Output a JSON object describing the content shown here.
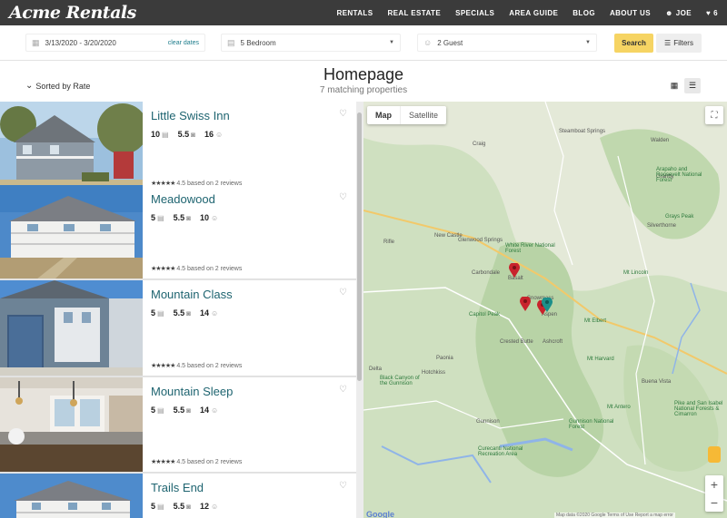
{
  "nav": {
    "logo": "Acme Rentals",
    "links": [
      "RENTALS",
      "REAL ESTATE",
      "SPECIALS",
      "AREA GUIDE",
      "BLOG",
      "ABOUT US"
    ],
    "user": "JOE",
    "favorites_count": "6"
  },
  "search": {
    "dates": "3/13/2020 - 3/20/2020",
    "clear_dates": "clear dates",
    "bedrooms": "5 Bedroom",
    "guests": "2 Guest",
    "search_label": "Search",
    "filters_label": "Filters"
  },
  "page": {
    "title": "Homepage",
    "subtitle": "7 matching properties",
    "sort_label": "Sorted by Rate"
  },
  "properties": [
    {
      "name": "Little Swiss Inn",
      "beds": "10",
      "baths": "5.5",
      "guests": "16",
      "rating": "4.5",
      "reviews": "based on 2 reviews"
    },
    {
      "name": "Meadowood",
      "beds": "5",
      "baths": "5.5",
      "guests": "10",
      "rating": "4.5",
      "reviews": "based on 2 reviews"
    },
    {
      "name": "Mountain Class",
      "beds": "5",
      "baths": "5.5",
      "guests": "14",
      "rating": "4.5",
      "reviews": "based on 2 reviews"
    },
    {
      "name": "Mountain Sleep",
      "beds": "5",
      "baths": "5.5",
      "guests": "14",
      "rating": "4.5",
      "reviews": "based on 2 reviews"
    },
    {
      "name": "Trails End",
      "beds": "5",
      "baths": "5.5",
      "guests": "12",
      "rating": "",
      "reviews": ""
    }
  ],
  "map": {
    "map_tab": "Map",
    "satellite_tab": "Satellite",
    "logo_text": "Google",
    "copyright": "Map data ©2020 Google   Terms of Use   Report a map error",
    "places": [
      {
        "name": "Craig"
      },
      {
        "name": "Steamboat Springs"
      },
      {
        "name": "Walden"
      },
      {
        "name": "Rifle"
      },
      {
        "name": "New Castle"
      },
      {
        "name": "Glenwood Springs"
      },
      {
        "name": "Carbondale"
      },
      {
        "name": "Basalt"
      },
      {
        "name": "Aspen"
      },
      {
        "name": "Snowmass"
      },
      {
        "name": "Capitol Peak"
      },
      {
        "name": "Mt Elbert"
      },
      {
        "name": "Ashcroft"
      },
      {
        "name": "Mt Harvard"
      },
      {
        "name": "Mt Lincoln"
      },
      {
        "name": "Silverthorne"
      },
      {
        "name": "Grays Peak"
      },
      {
        "name": "Granby"
      },
      {
        "name": "Buena Vista"
      },
      {
        "name": "Gunnison"
      },
      {
        "name": "Crested Butte"
      },
      {
        "name": "Paonia"
      },
      {
        "name": "Hotchkiss"
      },
      {
        "name": "Delta"
      },
      {
        "name": "Mt Antero"
      },
      {
        "name": "White River National Forest"
      },
      {
        "name": "Arapaho and Roosevelt National Forest"
      },
      {
        "name": "Pike and San Isabel National Forests & Cimarron"
      },
      {
        "name": "Gunnison National Forest"
      },
      {
        "name": "Curecanti National Recreation Area"
      },
      {
        "name": "Black Canyon of the Gunnison"
      }
    ]
  },
  "colors": {
    "accent": "#f6d463",
    "title_teal": "#1e6470",
    "pin_red": "#c8232c",
    "nav_bg": "#3b3b3b"
  }
}
